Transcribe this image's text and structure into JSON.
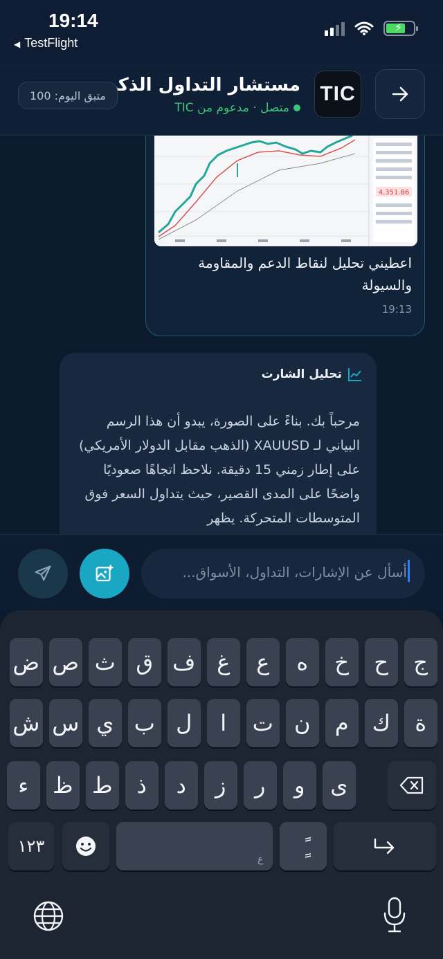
{
  "status_bar": {
    "time": "19:14",
    "back_app": "TestFlight"
  },
  "header": {
    "title": "مستشار التداول الذكي",
    "status": "متصل · مدعوم من TIC",
    "logo_text": "TIC",
    "quota": "متبق اليوم: 100"
  },
  "chat": {
    "user_message": {
      "text": "اعطيني تحليل لنقاط الدعم والمقاومة والسيولة",
      "time": "19:13",
      "image_price_label": "4,351.86"
    },
    "bot_message": {
      "title": "تحليل الشارت",
      "text": "مرحباً بك. بناءً على الصورة، يبدو أن هذا الرسم البياني لـ XAUUSD (الذهب مقابل الدولار الأمريكي) على إطار زمني 15 دقيقة. نلاحظ اتجاهًا صعوديًا واضحًا على المدى القصير، حيث يتداول السعر فوق المتوسطات المتحركة. يظهر"
    }
  },
  "input": {
    "placeholder": "أسأل عن الإشارات، التداول، الأسواق..."
  },
  "keyboard": {
    "row1": [
      "ج",
      "ح",
      "خ",
      "ه",
      "ع",
      "غ",
      "ف",
      "ق",
      "ث",
      "ص",
      "ض"
    ],
    "row2": [
      "ة",
      "ك",
      "م",
      "ن",
      "ت",
      "ا",
      "ل",
      "ب",
      "ي",
      "س",
      "ش"
    ],
    "row3": [
      "ى",
      "و",
      "ر",
      "ز",
      "د",
      "ذ",
      "ط",
      "ظ",
      "ء"
    ],
    "numbers_key": "١٢٣",
    "space_sub": "ع",
    "tanween_key": "ًٍ"
  },
  "colors": {
    "accent": "#1aa7c4",
    "online": "#3ec47a",
    "background": "#0c1a2e"
  }
}
